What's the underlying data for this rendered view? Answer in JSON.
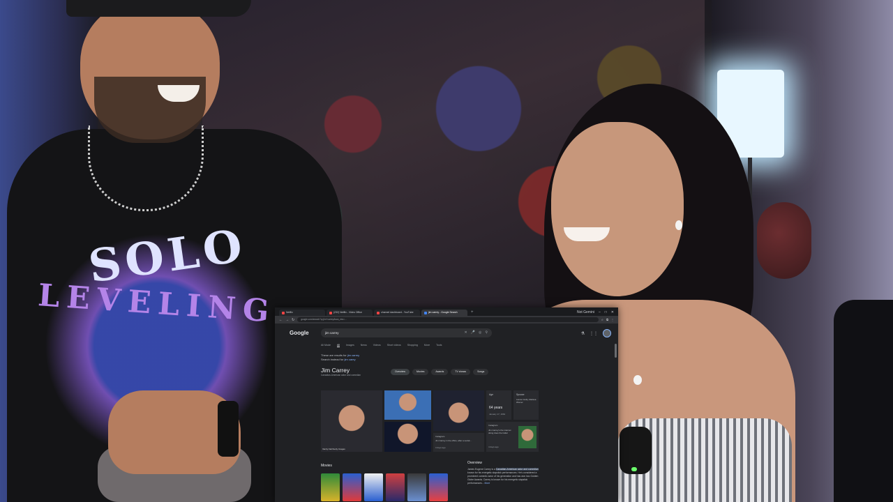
{
  "browser": {
    "tabs": [
      {
        "label": "Netflix"
      },
      {
        "label": "(232) Netflix - Video Office"
      },
      {
        "label": "channel dashboard - YouTube"
      },
      {
        "label": "jim carrey - Google Search",
        "active": true
      }
    ],
    "window_label": "Not Gemini",
    "url": "google.com/search?q=jim+carrey&sca_esv=..."
  },
  "google": {
    "logo": "Google",
    "query": "jim carrey",
    "tabs": [
      "All Mode",
      "All",
      "Images",
      "News",
      "Videos",
      "Short videos",
      "Shopping",
      "More",
      "Tools"
    ],
    "active_tab": "All",
    "note_line1_prefix": "These are results for",
    "note_line1_term": "jim carrey",
    "note_line2_prefix": "Search instead for",
    "note_line2_term": "jim carey",
    "entity": {
      "name": "Jim Carrey",
      "subtitle": "Canadian-American actor and comedian"
    },
    "chips": [
      "Overview",
      "Movies",
      "Awards",
      "TV shows",
      "Songs"
    ],
    "active_chip": "Overview",
    "image_caption": "Vanity Fair/Getty Images",
    "age_card": {
      "title": "Age",
      "value": "64 years",
      "date": "January 17, 1962"
    },
    "spouse_card": {
      "title": "Spouse",
      "names": "Lauren Holly, Melissa Womer"
    },
    "news1": {
      "source": "Instagram",
      "text": "Jim Carrey in the office, after a social...",
      "time": "3 days ago"
    },
    "news2": {
      "source": "Instagram",
      "text": "Jim Carrey's the internet doing does the trailer",
      "time": "4 days ago"
    },
    "movies_heading": "Movies",
    "movies": [
      "The Mask",
      "Sonic",
      "Dumb and Dumber",
      "Ace Ventura",
      "The Truman Show",
      "Sonic 2"
    ],
    "overview_heading": "Overview",
    "overview_hl": "Canadian-American actor and comedian",
    "overview_text_pre": "James Eugene Carrey is a",
    "overview_text_post": "known for his energetic slapstick performances. He's considered a prominent comedic actor of his generation and has won two Golden Globe Awards. Carrey is known for his energetic slapstick performances...",
    "overview_more": "More"
  }
}
